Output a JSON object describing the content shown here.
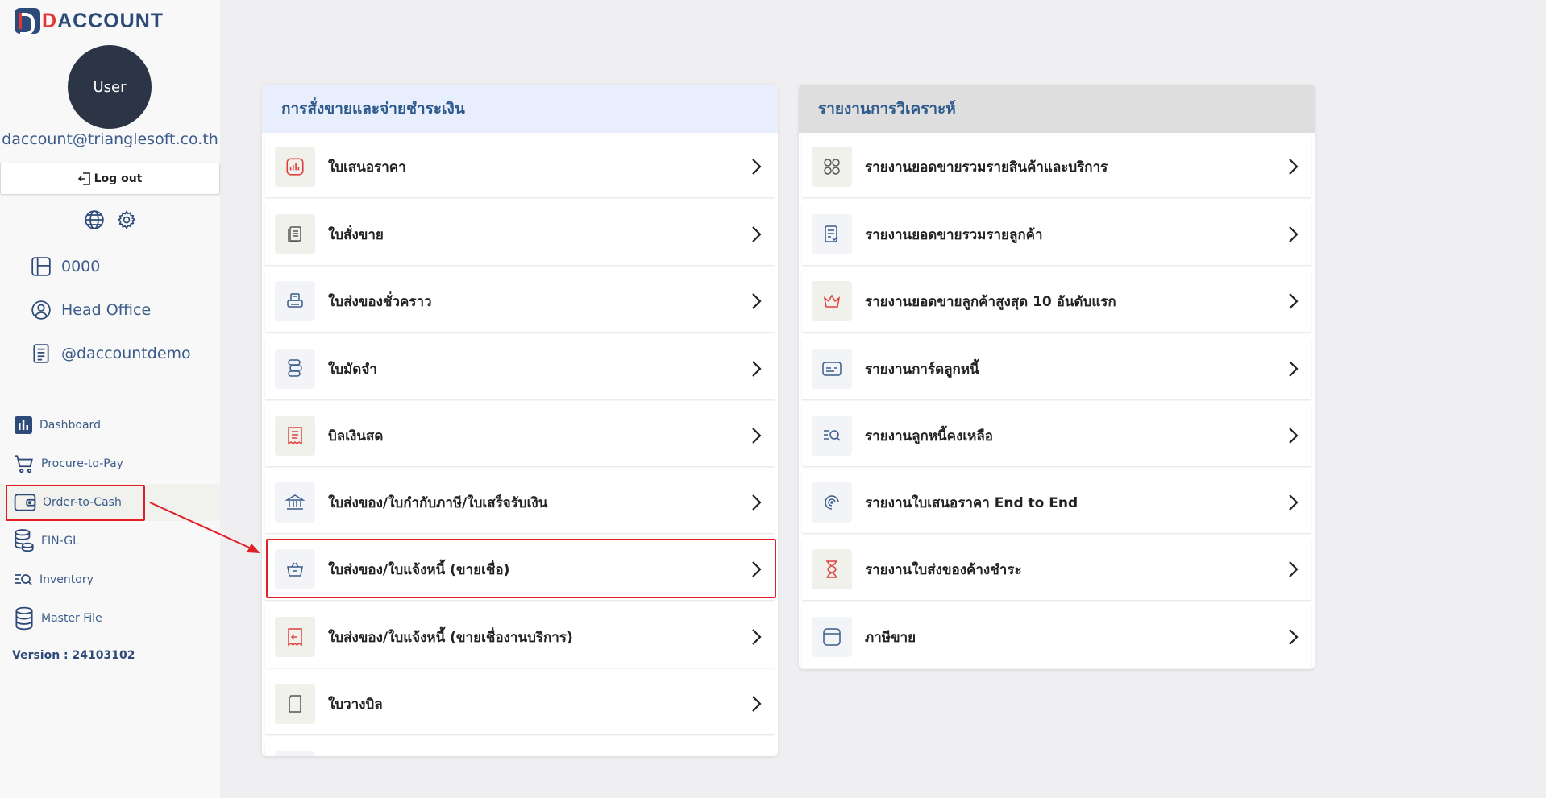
{
  "app": {
    "logo_text": "ACCOUNT"
  },
  "user": {
    "avatar_label": "User",
    "email": "daccount@trianglesoft.co.th",
    "logout_label": "Log out"
  },
  "context": {
    "company_code": "0000",
    "branch": "Head Office",
    "account": "@daccountdemo"
  },
  "nav": {
    "items": [
      {
        "label": "Dashboard",
        "icon": "bar-chart-icon"
      },
      {
        "label": "Procure-to-Pay",
        "icon": "cart-icon"
      },
      {
        "label": "Order-to-Cash",
        "icon": "wallet-icon",
        "active": true
      },
      {
        "label": "FIN-GL",
        "icon": "coins-icon"
      },
      {
        "label": "Inventory",
        "icon": "list-search-icon"
      },
      {
        "label": "Master File",
        "icon": "database-icon"
      }
    ]
  },
  "version": "Version : 24103102",
  "left_panel": {
    "title": "การสั่งขายและจ่ายชำระเงิน",
    "items": [
      {
        "label": "ใบเสนอราคา",
        "icon": "chart-doc-icon"
      },
      {
        "label": "ใบสั่งขาย",
        "icon": "documents-icon"
      },
      {
        "label": "ใบส่งของชั่วคราว",
        "icon": "printer-icon"
      },
      {
        "label": "ใบมัดจำ",
        "icon": "coin-stack-icon"
      },
      {
        "label": "บิลเงินสด",
        "icon": "receipt-icon"
      },
      {
        "label": "ใบส่งของ/ใบกำกับภาษี/ใบเสร็จรับเงิน",
        "icon": "bank-icon"
      },
      {
        "label": "ใบส่งของ/ใบแจ้งหนี้ (ขายเชื่อ)",
        "icon": "basket-icon"
      },
      {
        "label": "ใบส่งของ/ใบแจ้งหนี้ (ขายเชื่องานบริการ)",
        "icon": "return-receipt-icon"
      },
      {
        "label": "ใบวางบิล",
        "icon": "page-icon"
      }
    ]
  },
  "right_panel": {
    "title": "รายงานการวิเคราะห์",
    "items": [
      {
        "label": "รายงานยอดขายรวมรายสินค้าและบริการ",
        "icon": "grid-circles-icon"
      },
      {
        "label": "รายงานยอดขายรวมรายลูกค้า",
        "icon": "checklist-icon"
      },
      {
        "label": "รายงานยอดขายลูกค้าสูงสุด 10 อันดับแรก",
        "icon": "crown-icon"
      },
      {
        "label": "รายงานการ์ดลูกหนี้",
        "icon": "card-icon"
      },
      {
        "label": "รายงานลูกหนี้คงเหลือ",
        "icon": "list-search-icon"
      },
      {
        "label": "รายงานใบเสนอราคา End to End",
        "icon": "spiral-icon"
      },
      {
        "label": "รายงานใบส่งของค้างชำระ",
        "icon": "hourglass-icon"
      },
      {
        "label": "ภาษีขาย",
        "icon": "window-icon"
      }
    ]
  },
  "colors": {
    "accent": "#2e5a8c",
    "highlight": "#e01f26",
    "brand_red": "#e53535",
    "brand_blue": "#2e4a78"
  }
}
